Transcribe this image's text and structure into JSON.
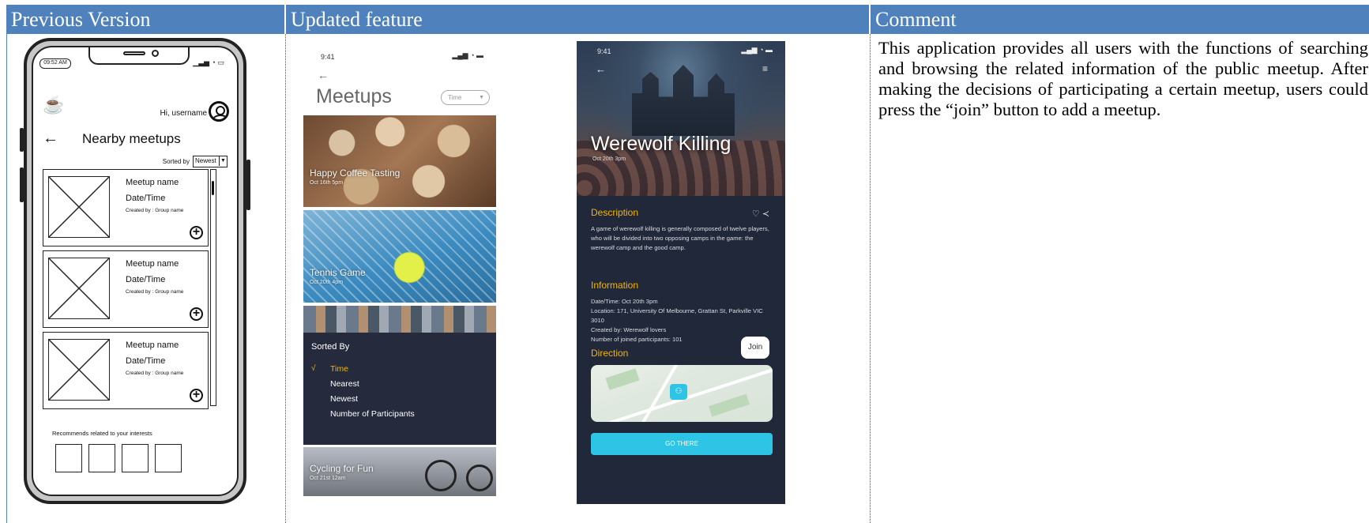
{
  "headers": {
    "previous": "Previous Version",
    "updated": "Updated feature",
    "comment": "Comment"
  },
  "comment_text": "This application provides all users with the functions of searching and browsing the related information of the public meetup. After making the decisions of participating a certain meetup, users could press the “join” button to add a meetup.",
  "wireframe": {
    "status_time": "09:52 AM",
    "greeting": "Hi, username",
    "title": "Nearby meetups",
    "sorted_by_label": "Sorted by",
    "sort_value": "Newest",
    "cards": [
      {
        "name": "Meetup name",
        "date": "Date/Time",
        "created_by": "Created by : Group name"
      },
      {
        "name": "Meetup name",
        "date": "Date/Time",
        "created_by": "Created by : Group name"
      },
      {
        "name": "Meetup name",
        "date": "Date/Time",
        "created_by": "Created by : Group name"
      }
    ],
    "recommend_label": "Recommends related to your interests"
  },
  "phone1": {
    "status_time": "9:41",
    "title": "Meetups",
    "time_select": "Time",
    "cards": [
      {
        "title": "Happy Coffee Tasting",
        "date": "Oct 16th 5pm"
      },
      {
        "title": "Tennis Game",
        "date": "Oct 20th 4pm"
      },
      {
        "title": "Cycling for Fun",
        "date": "Oct 21st 12am"
      }
    ],
    "sort_panel": {
      "title": "Sorted By",
      "check": "√",
      "options": [
        "Time",
        "Nearest",
        "Newest",
        "Number of Participants"
      ],
      "selected": "Time"
    }
  },
  "phone2": {
    "status_time": "9:41",
    "title": "Werewolf Killing",
    "date": "Oct 20th 3pm",
    "description_heading": "Description",
    "description": "A game of werewolf killing is generally composed of twelve players, who will be divided into two opposing camps in the game: the werewolf camp and the good camp.",
    "information_heading": "Information",
    "info_lines": [
      "Date/Time: Oct 20th 3pm",
      "Location: 171, University Of Melbourne, Grattan St, Parkville VIC 3010",
      "Created by: Werewolf lovers",
      "Number of joined participants: 101"
    ],
    "direction_heading": "Direction",
    "join_label": "Join",
    "go_label": "GO THERE"
  },
  "colors": {
    "header_bg": "#4f81bd",
    "accent_yellow": "#f4b400",
    "accent_cyan": "#2ec4e6",
    "dark_panel": "#21283a"
  }
}
